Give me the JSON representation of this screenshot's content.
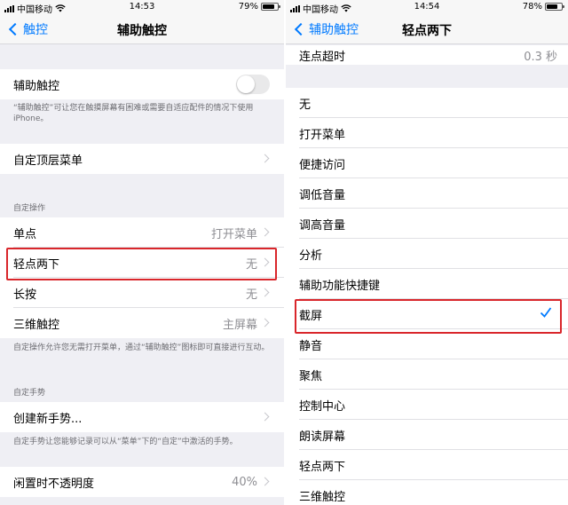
{
  "colors": {
    "accent": "#007aff",
    "highlight": "#d9262b",
    "background": "#efeff4"
  },
  "left": {
    "status": {
      "carrier": "中国移动",
      "time": "14:53",
      "battery": "79%",
      "battery_level": 0.79
    },
    "nav": {
      "back_label": "触控",
      "title": "辅助触控"
    },
    "assistive_touch": {
      "label": "辅助触控",
      "enabled": false
    },
    "assistive_note": "“辅助触控”可让您在触摸屏幕有困难或需要自适应配件的情况下使用iPhone。",
    "top_menu": {
      "label": "自定顶层菜单"
    },
    "custom_actions_header": "自定操作",
    "actions": [
      {
        "label": "单点",
        "value": "打开菜单"
      },
      {
        "label": "轻点两下",
        "value": "无"
      },
      {
        "label": "长按",
        "value": "无"
      },
      {
        "label": "三维触控",
        "value": "主屏幕"
      }
    ],
    "actions_note": "自定操作允许您无需打开菜单，通过“辅助触控”图标即可直接进行互动。",
    "gestures_header": "自定手势",
    "create_gesture": {
      "label": "创建新手势..."
    },
    "gesture_note": "自定手势让您能够记录可以从“菜单”下的“自定”中激活的手势。",
    "idle_opacity": {
      "label": "闲置时不透明度",
      "value": "40%"
    }
  },
  "right": {
    "status": {
      "carrier": "中国移动",
      "time": "14:54",
      "battery": "78%",
      "battery_level": 0.78
    },
    "nav": {
      "back_label": "辅助触控",
      "title": "轻点两下"
    },
    "timeout": {
      "label": "连点超时",
      "value": "0.3 秒"
    },
    "options": [
      {
        "label": "无"
      },
      {
        "label": "打开菜单"
      },
      {
        "label": "便捷访问"
      },
      {
        "label": "调低音量"
      },
      {
        "label": "调高音量"
      },
      {
        "label": "分析"
      },
      {
        "label": "辅助功能快捷键"
      },
      {
        "label": "截屏",
        "selected": true,
        "check_icon": "checkmark-icon"
      },
      {
        "label": "静音"
      },
      {
        "label": "聚焦"
      },
      {
        "label": "控制中心"
      },
      {
        "label": "朗读屏幕"
      },
      {
        "label": "轻点两下"
      },
      {
        "label": "三维触控"
      }
    ]
  }
}
